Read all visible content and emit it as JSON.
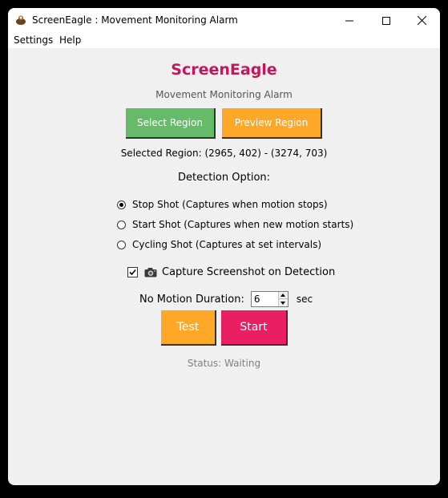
{
  "window": {
    "title": "ScreenEagle : Movement Monitoring Alarm",
    "app_icon": "eagle-icon"
  },
  "menu": {
    "items": [
      {
        "label": "Settings"
      },
      {
        "label": "Help"
      }
    ]
  },
  "header": {
    "title": "ScreenEagle",
    "subtitle": "Movement Monitoring Alarm",
    "title_color": "#c2185b"
  },
  "region": {
    "select_label": "Select Region",
    "preview_label": "Preview Region",
    "selected_text": "Selected Region: (2965, 402) - (3274, 703)"
  },
  "detection": {
    "label": "Detection Option:",
    "options": [
      {
        "label": "Stop Shot (Captures when motion stops)",
        "selected": true
      },
      {
        "label": "Start Shot (Captures when new motion starts)",
        "selected": false
      },
      {
        "label": "Cycling Shot (Captures at set intervals)",
        "selected": false
      }
    ]
  },
  "capture": {
    "label": "Capture Screenshot on Detection",
    "checked": true,
    "icon": "camera-icon"
  },
  "duration": {
    "label": "No Motion Duration:",
    "value": "6",
    "unit": "sec"
  },
  "actions": {
    "test_label": "Test",
    "start_label": "Start"
  },
  "status": {
    "text": "Status: Waiting"
  },
  "colors": {
    "select_button": "#66bb6a",
    "preview_button": "#ffa726",
    "test_button": "#ffa726",
    "start_button": "#e91e63"
  }
}
